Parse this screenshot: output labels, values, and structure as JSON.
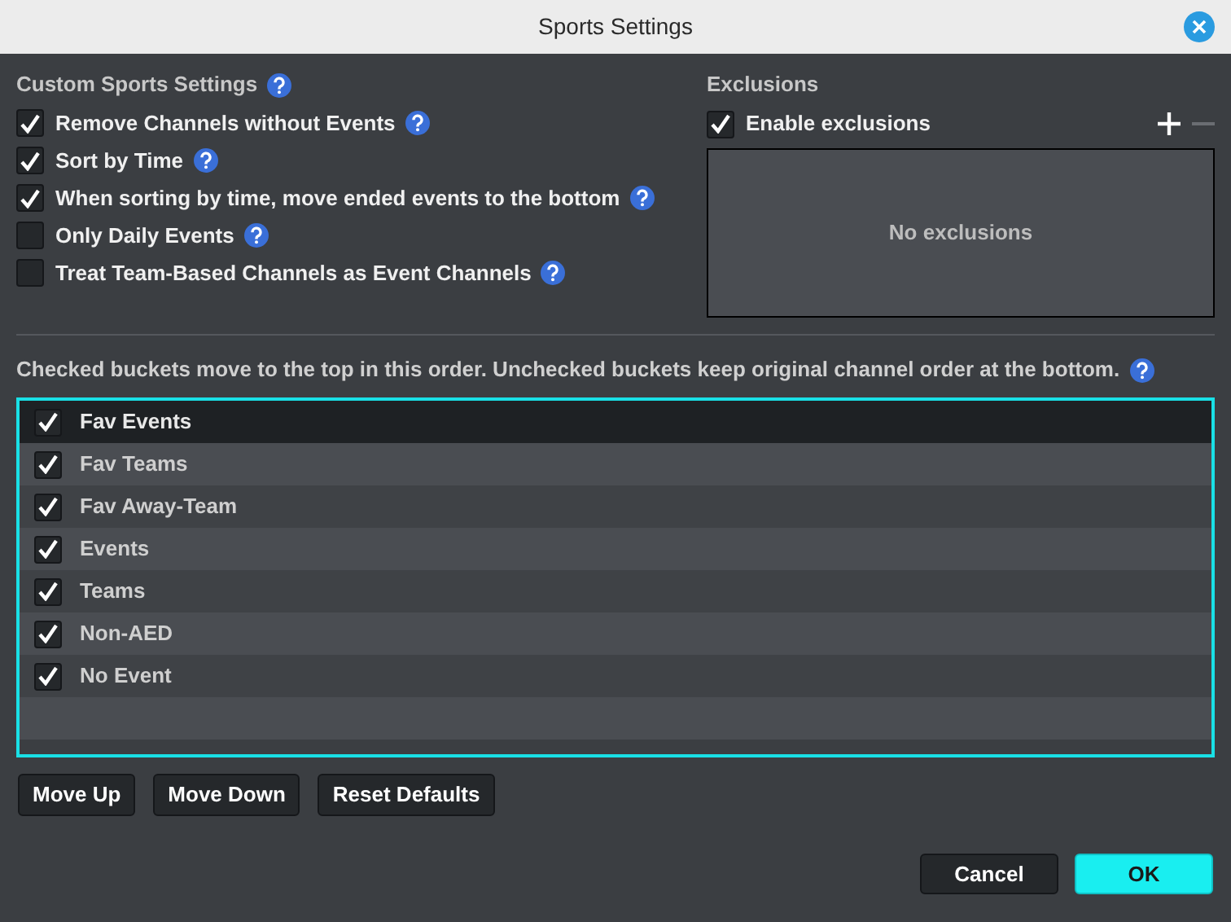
{
  "window": {
    "title": "Sports Settings"
  },
  "custom_settings": {
    "heading": "Custom Sports Settings",
    "options": [
      {
        "label": "Remove Channels without Events",
        "checked": true
      },
      {
        "label": "Sort by Time",
        "checked": true
      },
      {
        "label": "When sorting by time, move ended events to the bottom",
        "checked": true
      },
      {
        "label": "Only Daily Events",
        "checked": false
      },
      {
        "label": "Treat Team-Based Channels as Event Channels",
        "checked": false
      }
    ]
  },
  "exclusions": {
    "heading": "Exclusions",
    "enable": {
      "label": "Enable exclusions",
      "checked": true
    },
    "empty_text": "No exclusions"
  },
  "buckets": {
    "description": "Checked buckets move to the top in this order. Unchecked buckets keep original channel order at the bottom.",
    "items": [
      {
        "label": "Fav Events",
        "checked": true,
        "selected": true
      },
      {
        "label": "Fav Teams",
        "checked": true,
        "selected": false
      },
      {
        "label": "Fav Away-Team",
        "checked": true,
        "selected": false
      },
      {
        "label": "Events",
        "checked": true,
        "selected": false
      },
      {
        "label": "Teams",
        "checked": true,
        "selected": false
      },
      {
        "label": "Non-AED",
        "checked": true,
        "selected": false
      },
      {
        "label": "No Event",
        "checked": true,
        "selected": false
      }
    ]
  },
  "list_buttons": [
    "Move Up",
    "Move Down",
    "Reset Defaults"
  ],
  "dialog_buttons": [
    {
      "label": "Cancel",
      "kind": "normal"
    },
    {
      "label": "OK",
      "kind": "primary"
    }
  ]
}
